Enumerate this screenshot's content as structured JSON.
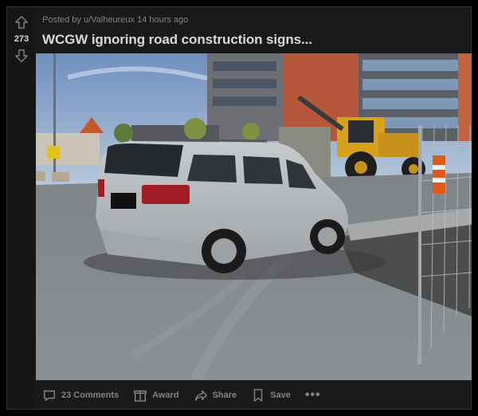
{
  "post": {
    "meta_prefix": "Posted by",
    "username": "u/Valheureux",
    "time_ago": "14 hours ago",
    "title": "WCGW ignoring road construction signs...",
    "score": "273"
  },
  "actions": {
    "comments": "23 Comments",
    "award": "Award",
    "share": "Share",
    "save": "Save",
    "more": "•••"
  },
  "colors": {
    "background": "#000000",
    "card": "#1a1a1b",
    "text": "#d7dadc",
    "muted": "#818384"
  },
  "icons": [
    "upvote-icon",
    "downvote-icon",
    "comment-icon",
    "award-icon",
    "share-icon",
    "save-icon",
    "more-icon"
  ]
}
